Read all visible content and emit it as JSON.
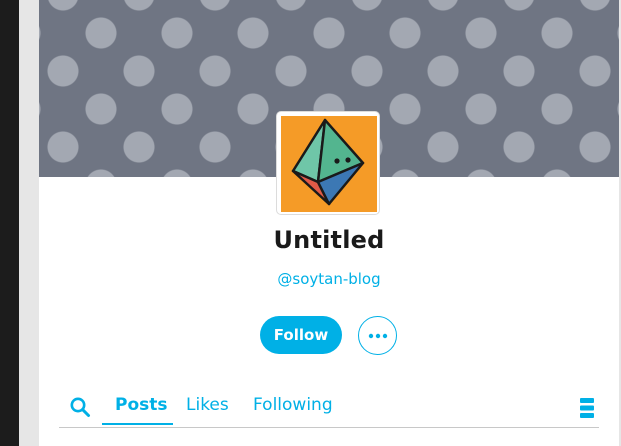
{
  "profile": {
    "title": "Untitled",
    "handle": "@soytan-blog",
    "avatar_icon": "octahedron-die-icon"
  },
  "actions": {
    "follow_label": "Follow",
    "more_icon": "more-horizontal-icon"
  },
  "tabs": [
    {
      "label": "Posts",
      "active": true
    },
    {
      "label": "Likes",
      "active": false
    },
    {
      "label": "Following",
      "active": false
    }
  ],
  "icons": {
    "search": "search-icon",
    "layout": "layout-stack-icon"
  },
  "colors": {
    "accent": "#00b0e6",
    "header_bg": "#6f7583",
    "header_dots": "#a3a8b2",
    "avatar_bg": "#f59b27"
  }
}
